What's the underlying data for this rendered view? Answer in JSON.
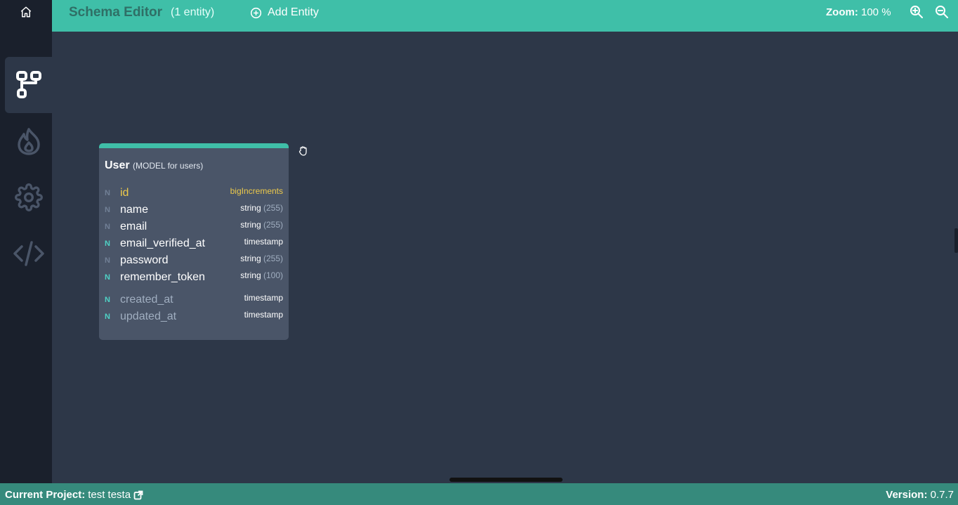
{
  "header": {
    "title": "Schema Editor",
    "entity_count": "(1 entity)",
    "add_entity_label": "Add Entity",
    "zoom_label": "Zoom:",
    "zoom_value": "100 %"
  },
  "sidebar": {
    "items": [
      {
        "icon": "home-icon"
      },
      {
        "icon": "schema-icon",
        "active": true
      },
      {
        "icon": "fire-icon"
      },
      {
        "icon": "gear-icon"
      },
      {
        "icon": "code-icon"
      }
    ]
  },
  "entity": {
    "name": "User",
    "subtitle": "(MODEL for users)",
    "fields": [
      {
        "flag": "N",
        "name": "id",
        "type": "bigIncrements",
        "length": ""
      },
      {
        "flag": "N",
        "name": "name",
        "type": "string",
        "length": "(255)"
      },
      {
        "flag": "N",
        "name": "email",
        "type": "string",
        "length": "(255)"
      },
      {
        "flag": "N",
        "name": "email_verified_at",
        "type": "timestamp",
        "length": ""
      },
      {
        "flag": "N",
        "name": "password",
        "type": "string",
        "length": "(255)"
      },
      {
        "flag": "N",
        "name": "remember_token",
        "type": "string",
        "length": "(100)"
      },
      {
        "flag": "N",
        "name": "created_at",
        "type": "timestamp",
        "length": ""
      },
      {
        "flag": "N",
        "name": "updated_at",
        "type": "timestamp",
        "length": ""
      }
    ]
  },
  "footer": {
    "project_label": "Current Project:",
    "project_name": "test testa",
    "version_label": "Version:",
    "version_value": "0.7.7"
  },
  "colors": {
    "accent": "#3fbfa8",
    "footer": "#368a7c",
    "sidebar": "#1a202c",
    "canvas": "#2d3748",
    "card": "#4a5568",
    "primary_key": "#ecc94b",
    "nullable_flag": "#4fd1c5",
    "muted_flag": "#a0aec0"
  }
}
